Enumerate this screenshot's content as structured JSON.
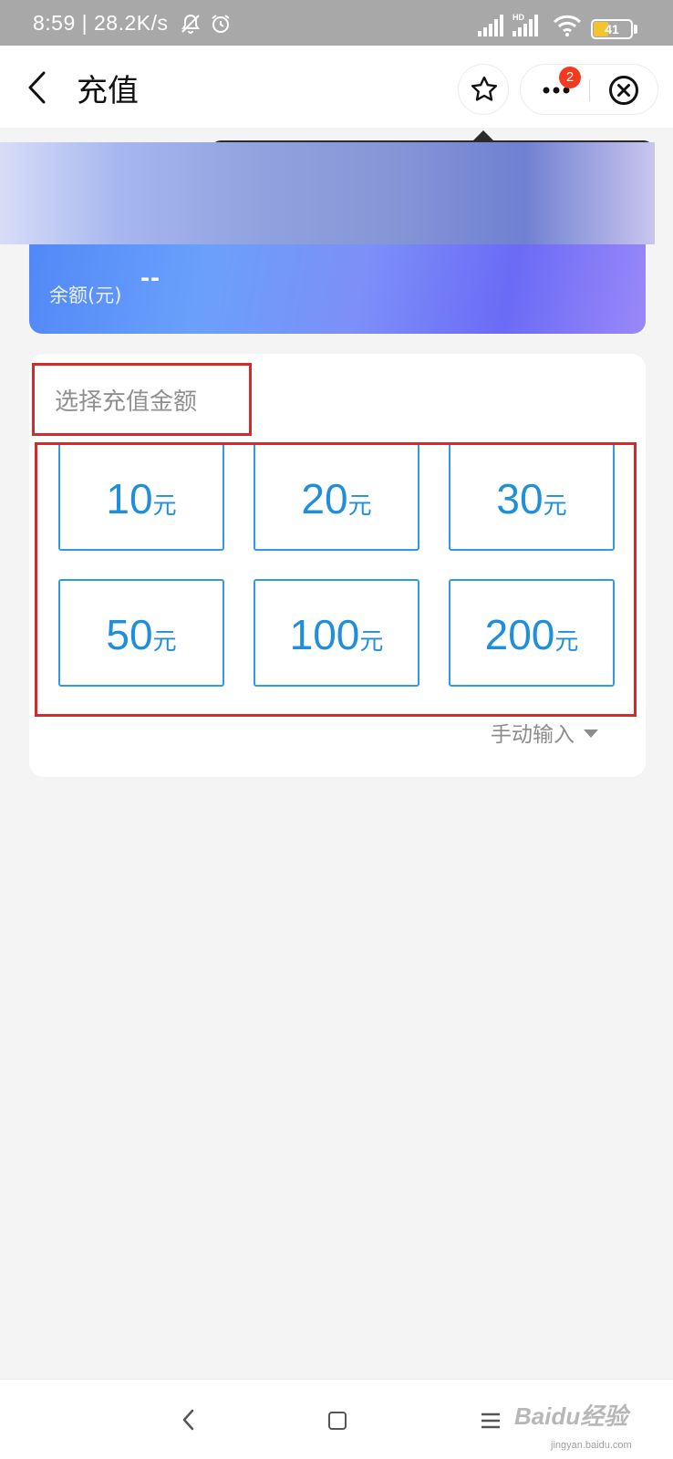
{
  "status_bar": {
    "text": "8:59 | 28.2K/s",
    "hd_label": "HD",
    "battery_level": "41",
    "battery_fraction": 0.41,
    "icons": [
      "bell-off-icon",
      "alarm-icon",
      "signal-icon",
      "hd-signal-icon",
      "wifi-icon",
      "battery-icon"
    ]
  },
  "nav": {
    "title": "充值",
    "more_badge": "2",
    "icons": [
      "back-icon",
      "star-icon",
      "more-icon",
      "close-circle-icon"
    ]
  },
  "balance": {
    "label": "余额(元)",
    "value": "--"
  },
  "amount_section": {
    "title": "选择充值金额",
    "unit": "元",
    "options": [
      "10",
      "20",
      "30",
      "50",
      "100",
      "200"
    ],
    "manual_input_label": "手动输入",
    "accent_color": "#1f8fdc",
    "highlight_color": "#d42a2a"
  },
  "bottom_nav": {
    "icons": [
      "system-back-icon",
      "home-icon",
      "menu-icon"
    ],
    "watermark": "Baidu经验",
    "watermark_sub": "jingyan.baidu.com"
  }
}
